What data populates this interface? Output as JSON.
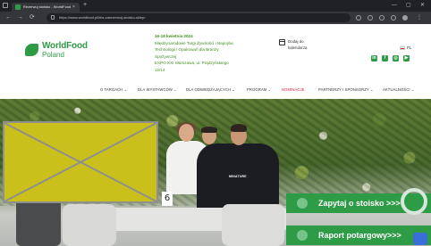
{
  "browser": {
    "tab_title": "Rezerwuj stoisko - WorldFood",
    "tab_close": "×",
    "new_tab": "+",
    "url": "https://www.worldfood.pl/ktw-zarezerwuj-stoisko-sklep/",
    "win_min": "—",
    "win_max": "▢",
    "win_close": "✕",
    "back": "←",
    "forward": "→",
    "reload": "⟳"
  },
  "logo": {
    "name": "WorldFood",
    "sub": "Poland"
  },
  "event": {
    "lines": [
      "16-18 kwietnia 2024",
      "Międzynarodowe Targi Żywności i Napojów,",
      "Technologii i Opakowań dla Branży",
      "Spożywczej",
      "EXPO XXI Warszawa, ul. Prądzyńskiego",
      "12/14"
    ]
  },
  "calendar": {
    "label": "Dodaj do kalendarza",
    "icon": "calendar-icon"
  },
  "language": {
    "label": "PL"
  },
  "social": {
    "icons": [
      "linkedin-icon",
      "facebook-icon",
      "instagram-icon",
      "youtube-icon"
    ],
    "glyphs": [
      "in",
      "f",
      "◎",
      "▶"
    ]
  },
  "nav": {
    "items": [
      "O TARGACH ⌄",
      "DLA WYSTAWCÓW ⌄",
      "DLA ODWIEDZAJĄCYCH ⌄",
      "PROGRAM ⌄",
      "NOMINACJE",
      "PARTNERZY I SPONSORZY ⌄",
      "AKTUALNOŚCI ⌄"
    ],
    "active_index": 4
  },
  "hero": {
    "table_number": "6",
    "shirt_logo": "MINATURE",
    "cta_ask": "Zapytaj o stoisko >>>",
    "cta_report": "Raport potargowy>>>"
  },
  "colors": {
    "brand_green": "#2e9b46",
    "accent_red": "#d4213d",
    "placeholder_fill": "#c9c01c"
  }
}
